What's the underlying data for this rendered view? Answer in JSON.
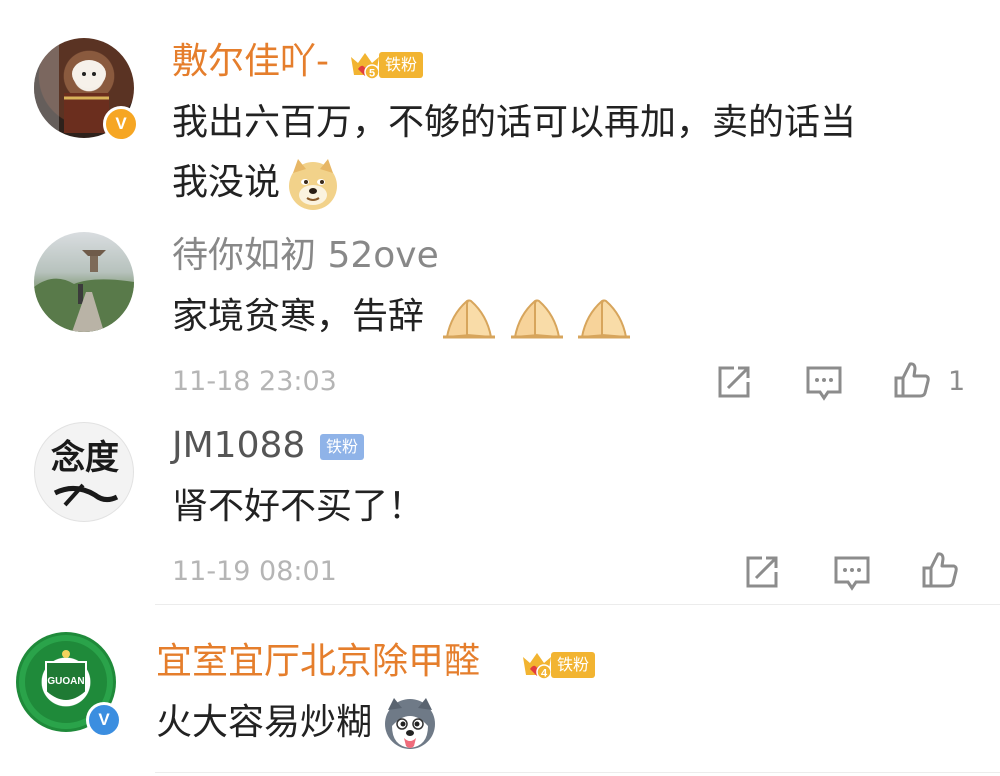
{
  "comments": [
    {
      "username": "敷尔佳吖-",
      "badge_text": "铁粉",
      "badge_level": "5",
      "verified_mark": "V",
      "text_line1": "我出六百万，不够的话可以再加，卖的话当",
      "text_line2": "我没说"
    },
    {
      "username": "待你如初 52ove",
      "text": "家境贫寒，告辞",
      "timestamp": "11-18 23:03",
      "like_count": "1"
    },
    {
      "username": "JM1088",
      "badge_text": "铁粉",
      "avatar_text": "念度",
      "text": "肾不好不买了！",
      "timestamp": "11-19 08:01"
    },
    {
      "username": "宜室宜厅北京除甲醛",
      "badge_text": "铁粉",
      "badge_level": "4",
      "verified_mark": "V",
      "avatar_text": "GUOAN",
      "text": "火大容易炒糊"
    }
  ],
  "icons": {
    "share": "share-icon",
    "comment": "comment-icon",
    "like": "thumbs-up-icon",
    "doge": "doge-emoji",
    "pray": "pray-emoji",
    "husky": "husky-emoji"
  },
  "colors": {
    "username_orange": "#e57e2c",
    "fan_badge_gold": "#f2b431",
    "fan_badge_blue": "#8fb3e8",
    "verified_orange": "#f6a623",
    "verified_blue": "#3b8ee0",
    "timestamp_gray": "#b5b5b5"
  }
}
